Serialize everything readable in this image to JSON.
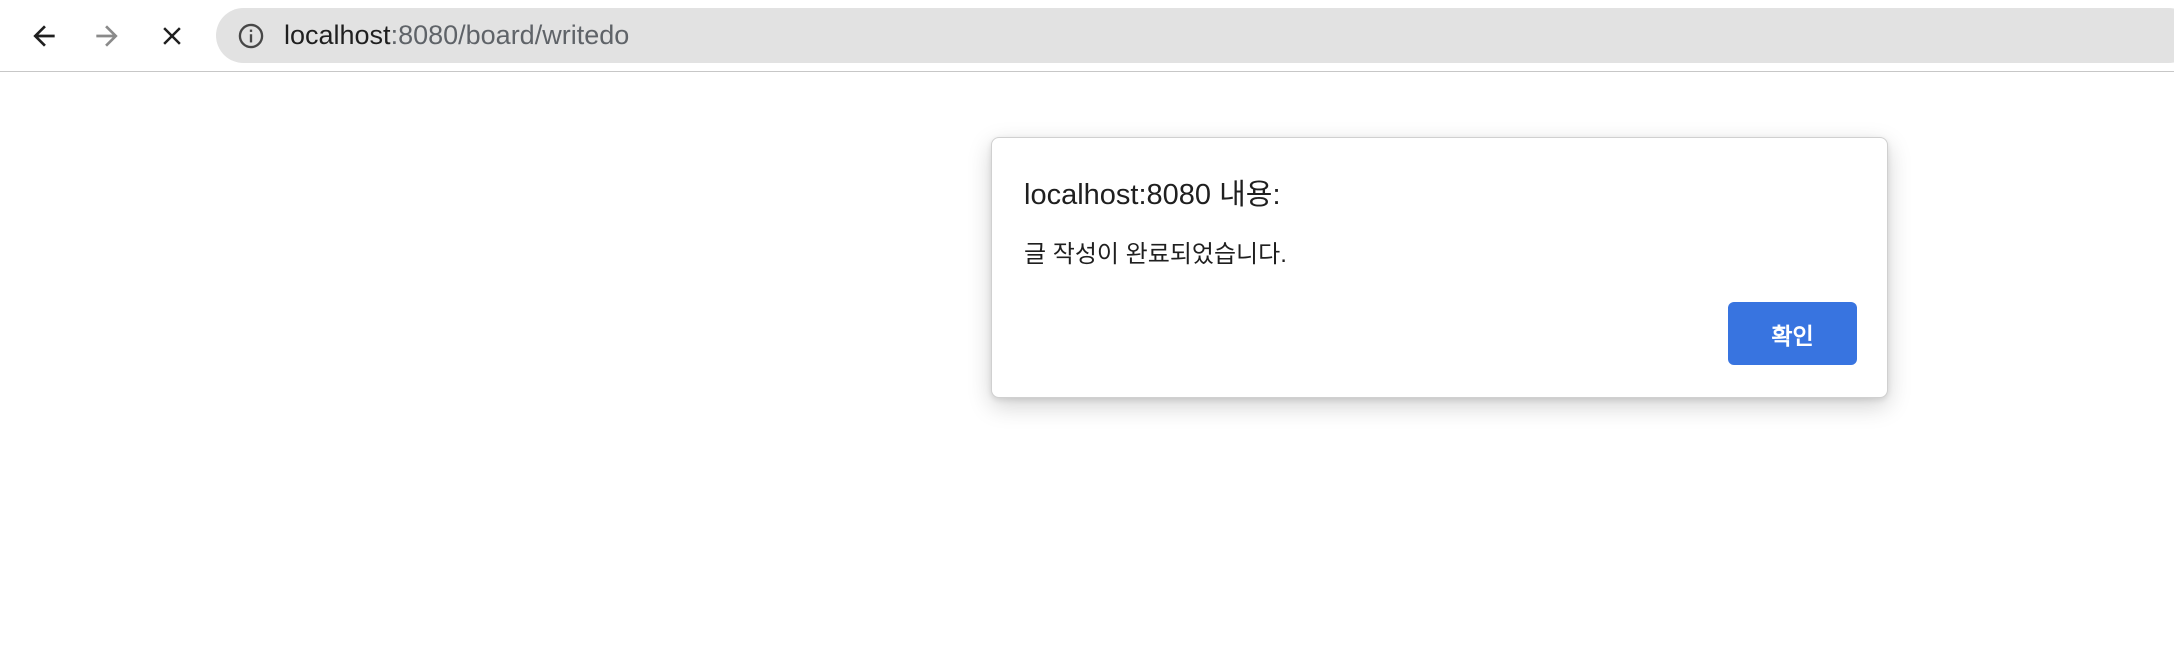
{
  "browser": {
    "address_bar": {
      "host": "localhost",
      "rest": ":8080/board/writedo"
    },
    "icons": {
      "back": "arrow-left-icon",
      "forward": "arrow-right-icon",
      "stop": "close-icon",
      "site_info": "info-icon"
    }
  },
  "dialog": {
    "title": "localhost:8080 내용:",
    "message": "글 작성이 완료되었습니다.",
    "ok_label": "확인"
  },
  "colors": {
    "accent": "#3874e0",
    "omnibox_bg": "#e2e2e2",
    "text": "#1f1f1f",
    "muted": "#5f6368"
  }
}
